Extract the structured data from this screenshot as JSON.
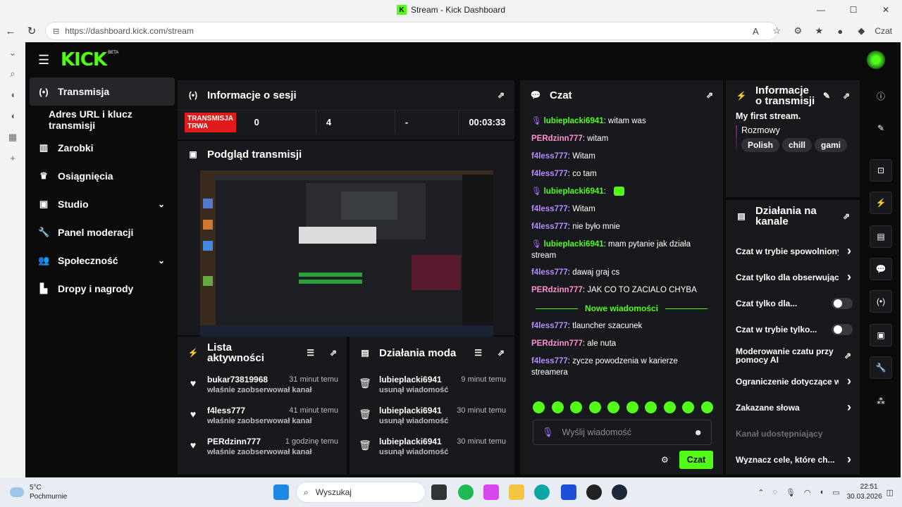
{
  "browser": {
    "title": "Stream - Kick Dashboard",
    "url": "https://dashboard.kick.com/stream",
    "profile_label": "Czat"
  },
  "nav": {
    "logo": "KICK",
    "beta": "BETA",
    "items": [
      {
        "label": "Transmisja",
        "icon": "broadcast-icon",
        "active": true
      },
      {
        "label": "Adres URL i klucz transmisji",
        "sub": true
      },
      {
        "label": "Zarobki",
        "icon": "chart-icon"
      },
      {
        "label": "Osiągnięcia",
        "icon": "trophy-icon"
      },
      {
        "label": "Studio",
        "icon": "studio-icon",
        "chevron": true
      },
      {
        "label": "Panel moderacji",
        "icon": "wrench-icon"
      },
      {
        "label": "Społeczność",
        "icon": "people-icon",
        "chevron": true
      },
      {
        "label": "Dropy i nagrody",
        "icon": "gift-icon"
      }
    ]
  },
  "session": {
    "title": "Informacje o sesji",
    "badge": "TRANSMISJA TRWA",
    "stat1": "0",
    "stat2": "4",
    "stat3": "-",
    "duration": "00:03:33"
  },
  "preview": {
    "title": "Podgląd transmisji"
  },
  "activity": {
    "title": "Lista aktywności",
    "items": [
      {
        "name": "bukar73819968",
        "action": "właśnie zaobserwował kanał",
        "time": "31 minut temu"
      },
      {
        "name": "f4less777",
        "action": "właśnie zaobserwował kanał",
        "time": "41 minut temu"
      },
      {
        "name": "PERdzinn777",
        "action": "właśnie zaobserwował kanał",
        "time": "1 godzinę temu"
      }
    ]
  },
  "modactions": {
    "title": "Działania moda",
    "items": [
      {
        "name": "lubieplacki6941",
        "action": "usunął wiadomość",
        "time": "9 minut temu"
      },
      {
        "name": "lubieplacki6941",
        "action": "usunął wiadomość",
        "time": "30 minut temu"
      },
      {
        "name": "lubieplacki6941",
        "action": "usunął wiadomość",
        "time": "30 minut temu"
      }
    ]
  },
  "chat": {
    "title": "Czat",
    "messages": [
      {
        "user": "lubieplacki6941",
        "text": "witam was",
        "color": "#53fc18",
        "mic": true
      },
      {
        "user": "PERdzinn777",
        "text": "witam",
        "color": "#ff8fd0"
      },
      {
        "user": "f4less777",
        "text": "Witam",
        "color": "#b48cff"
      },
      {
        "user": "f4less777",
        "text": "co tam",
        "color": "#b48cff"
      },
      {
        "user": "lubieplacki6941",
        "text": "",
        "color": "#53fc18",
        "mic": true,
        "emote": true
      },
      {
        "user": "f4less777",
        "text": "Witam",
        "color": "#b48cff"
      },
      {
        "user": "f4less777",
        "text": "nie było mnie",
        "color": "#b48cff"
      },
      {
        "user": "lubieplacki6941",
        "text": "mam pytanie jak działa stream",
        "color": "#53fc18",
        "mic": true
      },
      {
        "user": "f4less777",
        "text": "dawaj graj cs",
        "color": "#b48cff"
      },
      {
        "user": "PERdzinn777",
        "text": "JAK CO TO ZACIALO CHYBA",
        "color": "#ff8fd0"
      }
    ],
    "new_label": "Nowe wiadomości",
    "new_messages": [
      {
        "user": "f4less777",
        "text": "tlauncher szacunek",
        "color": "#b48cff"
      },
      {
        "user": "PERdzinn777",
        "text": "ale nuta",
        "color": "#ff8fd0"
      },
      {
        "user": "f4less777",
        "text": "zycze powodzenia w karierze streamera",
        "color": "#b48cff"
      }
    ],
    "placeholder": "Wyślij wiadomość",
    "send": "Czat"
  },
  "streaminfo": {
    "title_line1": "Informacje",
    "title_line2": "o transmisji",
    "stream_title": "My first stream.",
    "category": "Rozmowy",
    "tags": [
      "Polish",
      "chill",
      "gami"
    ]
  },
  "channel": {
    "title_line1": "Działania na",
    "title_line2": "kanale",
    "items": [
      {
        "label": "Czat w trybie spowolnionym",
        "type": "arrow"
      },
      {
        "label": "Czat tylko dla obserwujących",
        "type": "arrow"
      },
      {
        "label": "Czat tylko dla...",
        "type": "toggle"
      },
      {
        "label": "Czat w trybie tylko...",
        "type": "toggle"
      },
      {
        "label": "Moderowanie czatu przy pomocy AI",
        "type": "external"
      },
      {
        "label": "Ograniczenie dotyczące w",
        "type": "arrow"
      },
      {
        "label": "Zakazane słowa",
        "type": "arrow"
      },
      {
        "label": "Kanał udostępniający",
        "type": "disabled"
      },
      {
        "label": "Wyznacz cele, które ch...",
        "type": "arrow"
      }
    ]
  },
  "taskbar": {
    "temp": "5°C",
    "weather": "Pochmurnie",
    "search": "Wyszukaj",
    "time": "22:51",
    "date": "30.03.2026"
  }
}
